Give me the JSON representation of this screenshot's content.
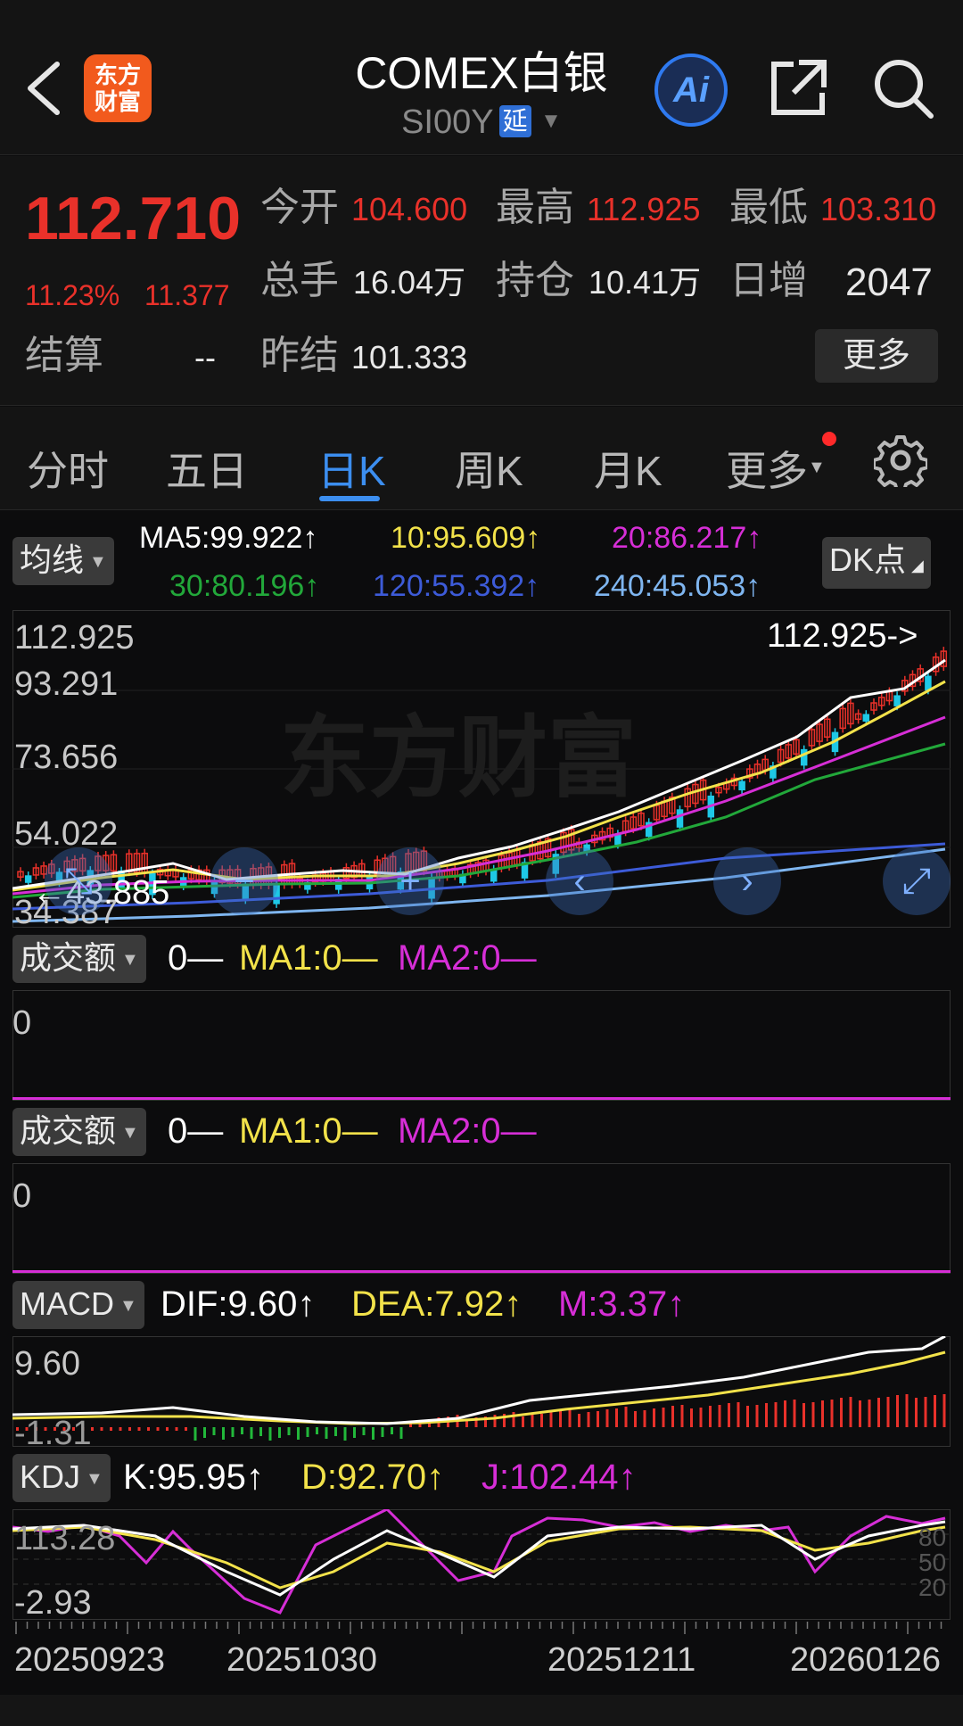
{
  "header": {
    "logo_text": "东方财富",
    "title": "COMEX白银",
    "code": "SI00Y",
    "delay_badge": "延",
    "ai_label": "Ai",
    "icons": [
      "back-arrow-icon",
      "ai-icon",
      "share-icon",
      "search-icon"
    ]
  },
  "quote": {
    "price": "112.710",
    "change_pct": "11.23%",
    "change": "11.377",
    "open_label": "今开",
    "open": "104.600",
    "high_label": "最高",
    "high": "112.925",
    "low_label": "最低",
    "low": "103.310",
    "volume_label": "总手",
    "volume": "16.04万",
    "oi_label": "持仓",
    "oi": "10.41万",
    "daily_inc_label": "日增",
    "daily_inc": "2047",
    "settle_label": "结算",
    "settle": "--",
    "prev_settle_label": "昨结",
    "prev_settle": "101.333",
    "more_label": "更多"
  },
  "tabs": {
    "items": [
      "分时",
      "五日",
      "日K",
      "周K",
      "月K",
      "更多"
    ],
    "active": "日K",
    "settings_icon": "gear-icon"
  },
  "kline": {
    "selector": "均线",
    "dk_label": "DK点",
    "ma5": "MA5:99.922↑",
    "ma10": "10:95.609↑",
    "ma20": "20:86.217↑",
    "ma30": "30:80.196↑",
    "ma120": "120:55.392↑",
    "ma240": "240:45.053↑",
    "y_labels": [
      "112.925",
      "93.291",
      "73.656",
      "54.022",
      "34.387"
    ],
    "max_marker": "112.925->",
    "min_marker": "←43.885",
    "watermark": "东方财富",
    "nav_icons": [
      "zoom-out-icon",
      "minus-icon",
      "plus-icon",
      "left-arrow-icon",
      "right-arrow-icon",
      "expand-icon"
    ]
  },
  "volume1": {
    "selector": "成交额",
    "v": "0—",
    "ma1": "MA1:0—",
    "ma2": "MA2:0—",
    "y_label": "0"
  },
  "volume2": {
    "selector": "成交额",
    "v": "0—",
    "ma1": "MA1:0—",
    "ma2": "MA2:0—",
    "y_label": "0"
  },
  "macd": {
    "selector": "MACD",
    "dif": "DIF:9.60↑",
    "dea": "DEA:7.92↑",
    "m": "M:3.37↑",
    "y_top": "9.60",
    "y_bottom": "-1.31"
  },
  "kdj": {
    "selector": "KDJ",
    "k": "K:95.95↑",
    "d": "D:92.70↑",
    "j": "J:102.44↑",
    "y_top": "113.28",
    "y_bottom": "-2.93",
    "levels": [
      "80",
      "50",
      "20"
    ]
  },
  "dates": [
    "20250923",
    "20251030",
    "20251211",
    "20260126"
  ],
  "colors": {
    "up": "#e9312a",
    "down": "#1ec8e6",
    "ma5": "#ffffff",
    "ma10": "#f2e24a",
    "ma20": "#d62ed6",
    "ma30": "#22a83a",
    "ma120": "#3d5bd8",
    "ma240": "#7fb6f0",
    "accent": "#3c8ef0"
  }
}
